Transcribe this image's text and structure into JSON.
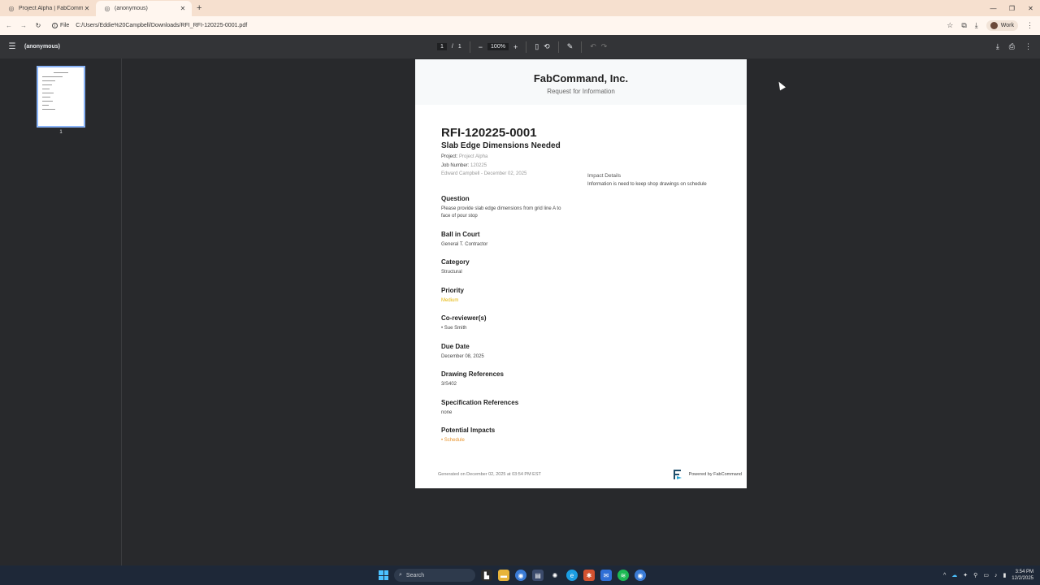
{
  "browser": {
    "tabs": [
      {
        "title": "Project Alpha | FabCommand",
        "active": false
      },
      {
        "title": "(anonymous)",
        "active": true
      }
    ],
    "address": {
      "scheme_label": "File",
      "url": "C:/Users/Eddie%20Campbell/Downloads/RFI_RFI-120225-0001.pdf"
    },
    "profile": "Work"
  },
  "pdf_viewer": {
    "doc_title": "(anonymous)",
    "page_current": "1",
    "page_sep": "/",
    "page_total": "1",
    "zoom": "100%",
    "thumbnail_label": "1"
  },
  "document": {
    "company": "FabCommand, Inc.",
    "doc_type": "Request for Information",
    "rfi_number": "RFI-120225-0001",
    "subject": "Slab Edge Dimensions Needed",
    "project_label": "Project:",
    "project_value": "Project Alpha",
    "job_label": "Job Number:",
    "job_value": "120225",
    "author_line": "Edward Campbell - December 02, 2025",
    "impact_heading": "Impact Details",
    "impact_text": "Information is need to keep shop drawings on schedule",
    "sections": [
      {
        "heading": "Question",
        "value": "Please provide slab edge dimensions from grid line A to face of pour stop"
      },
      {
        "heading": "Ball in Court",
        "value": "General T. Contractor"
      },
      {
        "heading": "Category",
        "value": "Structural"
      },
      {
        "heading": "Priority",
        "value": "Medium"
      },
      {
        "heading": "Co-reviewer(s)",
        "value": "• Sue Smith"
      },
      {
        "heading": "Due Date",
        "value": "December 08, 2025"
      },
      {
        "heading": "Drawing References",
        "value": "3/S402"
      },
      {
        "heading": "Specification References",
        "value": "none"
      },
      {
        "heading": "Potential Impacts",
        "value": "• Schedule"
      }
    ],
    "footer_generated": "Generated on December 02, 2025 at 03:54 PM EST",
    "footer_powered_prefix": "Powered by ",
    "footer_powered_brand": "FabCommand"
  },
  "taskbar": {
    "search_placeholder": "Search",
    "time": "3:54 PM",
    "date": "12/2/2025"
  },
  "colors": {
    "priority_medium": "#e4b400",
    "impact_schedule": "#e8922a",
    "accent": "#8ab4f8"
  }
}
